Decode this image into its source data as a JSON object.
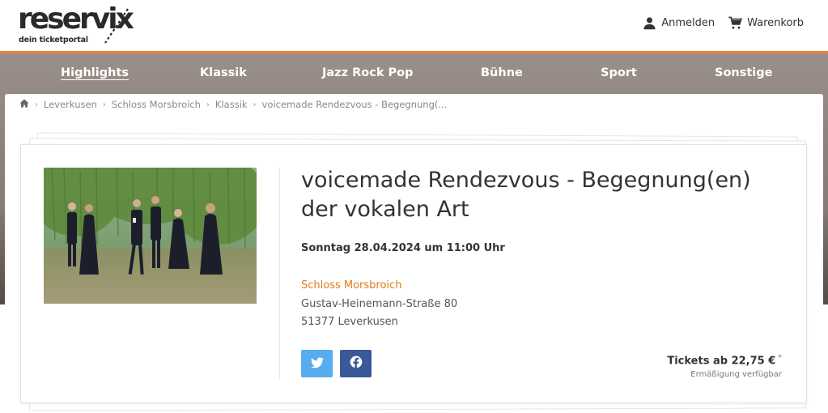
{
  "brand": {
    "logo_text": "reservix",
    "tagline": "dein ticketportal"
  },
  "header": {
    "login_label": "Anmelden",
    "cart_label": "Warenkorb",
    "login_icon": "person-icon",
    "cart_icon": "cart-icon"
  },
  "nav": {
    "items": [
      {
        "label": "Highlights",
        "active": true
      },
      {
        "label": "Klassik",
        "active": false
      },
      {
        "label": "Jazz Rock Pop",
        "active": false
      },
      {
        "label": "Bühne",
        "active": false
      },
      {
        "label": "Sport",
        "active": false
      },
      {
        "label": "Sonstige",
        "active": false
      }
    ]
  },
  "breadcrumb": {
    "home_icon": "home-icon",
    "items": [
      "Leverkusen",
      "Schloss Morsbroich",
      "Klassik",
      "voicemade Rendezvous - Begegnung(..."
    ]
  },
  "event": {
    "title": "voicemade Rendezvous - Begegnung(en) der vokalen Art",
    "date": "Sonntag 28.04.2024 um 11:00 Uhr",
    "venue_name": "Schloss Morsbroich",
    "venue_street": "Gustav-Heinemann-Straße 80",
    "venue_city": "51377 Leverkusen",
    "tickets_label": "Tickets ab 22,75 €",
    "tickets_asterisk": "*",
    "discount_note": "Ermäßigung verfügbar"
  },
  "share": {
    "twitter_icon": "twitter-icon",
    "facebook_icon": "facebook-icon"
  },
  "colors": {
    "accent": "#e8843a",
    "venue_link": "#e07b1e",
    "twitter": "#55acee",
    "facebook": "#3b5998"
  }
}
